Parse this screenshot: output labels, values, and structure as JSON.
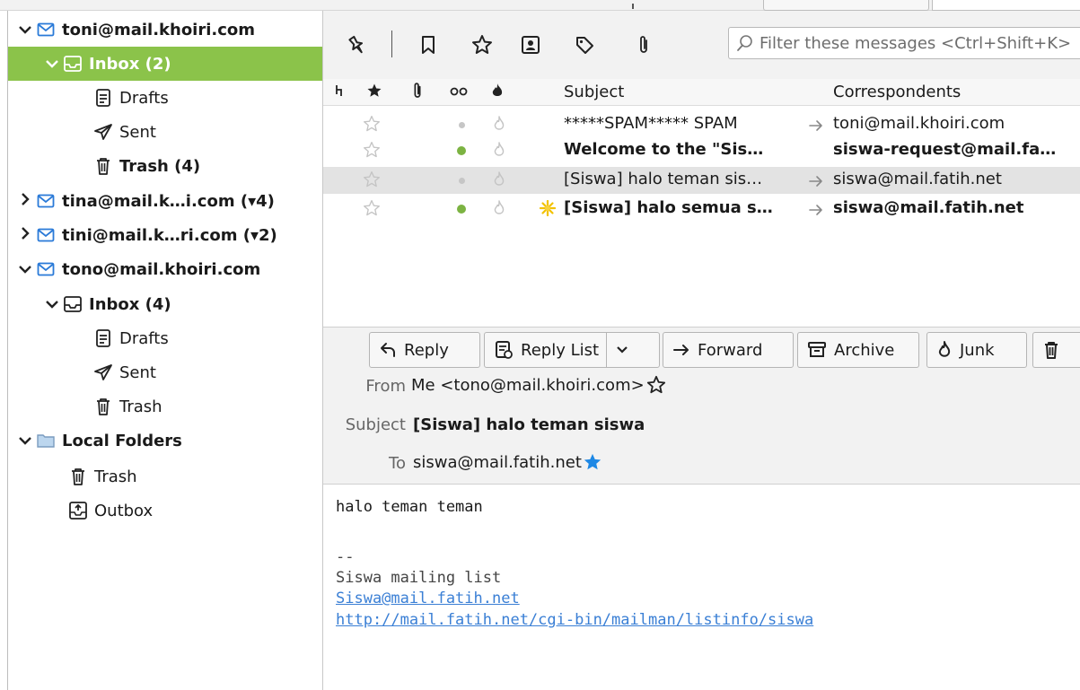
{
  "folders": [
    {
      "id": "acct-toni",
      "twisty": "open",
      "icon": "mail",
      "label": "toni@mail.khoiri.com",
      "bold": true,
      "indent": 0
    },
    {
      "id": "toni-inbox",
      "twisty": "open",
      "icon": "inbox",
      "label": "Inbox (2)",
      "bold": true,
      "indent": 1,
      "selected": true
    },
    {
      "id": "toni-drafts",
      "twisty": "",
      "icon": "drafts",
      "label": "Drafts",
      "bold": false,
      "indent": 2
    },
    {
      "id": "toni-sent",
      "twisty": "",
      "icon": "sent",
      "label": "Sent",
      "bold": false,
      "indent": 2
    },
    {
      "id": "toni-trash",
      "twisty": "",
      "icon": "trash",
      "label": "Trash (4)",
      "bold": true,
      "indent": 2
    },
    {
      "id": "acct-tina",
      "twisty": "closed",
      "icon": "mail",
      "label": "tina@mail.k…i.com (▾4)",
      "bold": true,
      "indent": 0
    },
    {
      "id": "acct-tini",
      "twisty": "closed",
      "icon": "mail",
      "label": "tini@mail.k…ri.com (▾2)",
      "bold": true,
      "indent": 0
    },
    {
      "id": "acct-tono",
      "twisty": "open",
      "icon": "mail",
      "label": "tono@mail.khoiri.com",
      "bold": true,
      "indent": 0
    },
    {
      "id": "tono-inbox",
      "twisty": "open",
      "icon": "inbox",
      "label": "Inbox (4)",
      "bold": true,
      "indent": 1
    },
    {
      "id": "tono-drafts",
      "twisty": "",
      "icon": "drafts",
      "label": "Drafts",
      "bold": false,
      "indent": 2
    },
    {
      "id": "tono-sent",
      "twisty": "",
      "icon": "sent",
      "label": "Sent",
      "bold": false,
      "indent": 2
    },
    {
      "id": "tono-trash",
      "twisty": "",
      "icon": "trash",
      "label": "Trash",
      "bold": false,
      "indent": 2
    },
    {
      "id": "local-folders",
      "twisty": "open",
      "icon": "folder",
      "label": "Local Folders",
      "bold": true,
      "indent": 0
    },
    {
      "id": "local-trash",
      "twisty": "",
      "icon": "trash",
      "label": "Trash",
      "bold": false,
      "indent": 1
    },
    {
      "id": "local-outbox",
      "twisty": "",
      "icon": "outbox",
      "label": "Outbox",
      "bold": false,
      "indent": 1
    }
  ],
  "filter": {
    "placeholder": "Filter these messages <Ctrl+Shift+K>"
  },
  "columns": {
    "subject": "Subject",
    "correspondents": "Correspondents"
  },
  "messages": [
    {
      "subject": "*****SPAM***** SPAM",
      "correspondent": "toni@mail.khoiri.com",
      "unread": false,
      "new": false,
      "arrow": true,
      "current": false
    },
    {
      "subject": "Welcome to the \"Sis…",
      "correspondent": "siswa-request@mail.fa…",
      "unread": true,
      "new": false,
      "arrow": false,
      "current": false
    },
    {
      "subject": "[Siswa] halo teman sis…",
      "correspondent": "siswa@mail.fatih.net",
      "unread": false,
      "new": false,
      "arrow": true,
      "current": true
    },
    {
      "subject": "[Siswa] halo semua s…",
      "correspondent": "siswa@mail.fatih.net",
      "unread": true,
      "new": true,
      "arrow": true,
      "current": false
    }
  ],
  "header_buttons": {
    "reply": "Reply",
    "reply_list": "Reply List",
    "forward": "Forward",
    "archive": "Archive",
    "junk": "Junk"
  },
  "header": {
    "from_label": "From",
    "from_value": "Me <tono@mail.khoiri.com>",
    "subject_label": "Subject",
    "subject_value": "[Siswa] halo teman siswa",
    "to_label": "To",
    "to_value": "siswa@mail.fatih.net"
  },
  "body": {
    "line1": "halo teman teman",
    "sig_sep": "--",
    "sig1": "Siswa mailing list",
    "link1": "Siswa@mail.fatih.net",
    "link2": "http://mail.fatih.net/cgi-bin/mailman/listinfo/siswa"
  },
  "colors": {
    "selection": "#8bc34a",
    "unread_dot": "#7cb342",
    "link": "#3a7fd5",
    "star_blue": "#1e88e5"
  }
}
